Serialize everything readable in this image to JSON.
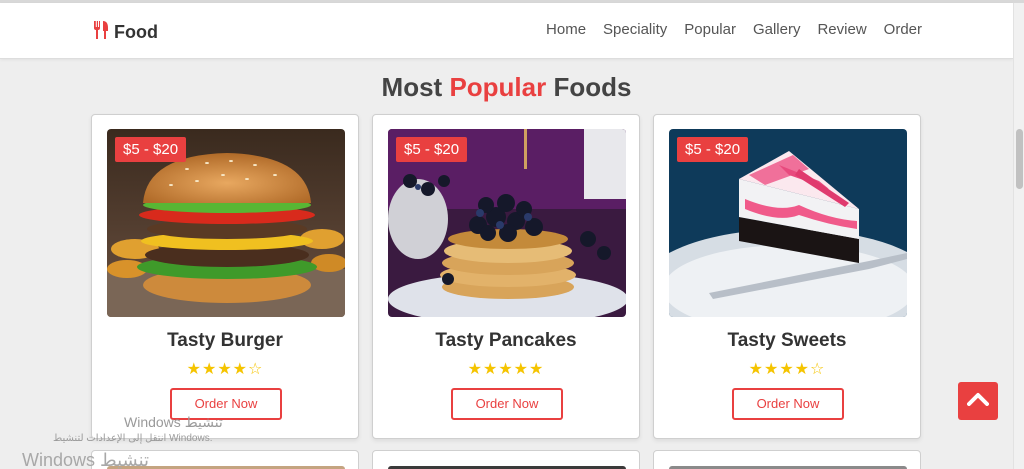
{
  "brand": {
    "name": "Food",
    "accent_color": "#e94040",
    "icon": "utensils-icon"
  },
  "nav": {
    "links": [
      "Home",
      "Speciality",
      "Popular",
      "Gallery",
      "Review",
      "Order"
    ]
  },
  "section": {
    "title_before": "Most ",
    "title_accent": "Popular",
    "title_after": " Foods"
  },
  "cards": [
    {
      "price": "$5 - $20",
      "title": "Tasty Burger",
      "rating": 4,
      "stars": "★★★★☆",
      "button": "Order Now",
      "image": "burger-image"
    },
    {
      "price": "$5 - $20",
      "title": "Tasty Pancakes",
      "rating": 5,
      "stars": "★★★★★",
      "button": "Order Now",
      "image": "pancakes-image"
    },
    {
      "price": "$5 - $20",
      "title": "Tasty Sweets",
      "rating": 4,
      "stars": "★★★★☆",
      "button": "Order Now",
      "image": "cake-image"
    }
  ],
  "scroll_top": {
    "icon": "chevron-up-icon"
  },
  "watermark": {
    "line1": "Windows تنشيط",
    "line2": "انتقل إلى الإعدادات لتنشيط Windows.",
    "line3": "Windows تنشيط"
  }
}
